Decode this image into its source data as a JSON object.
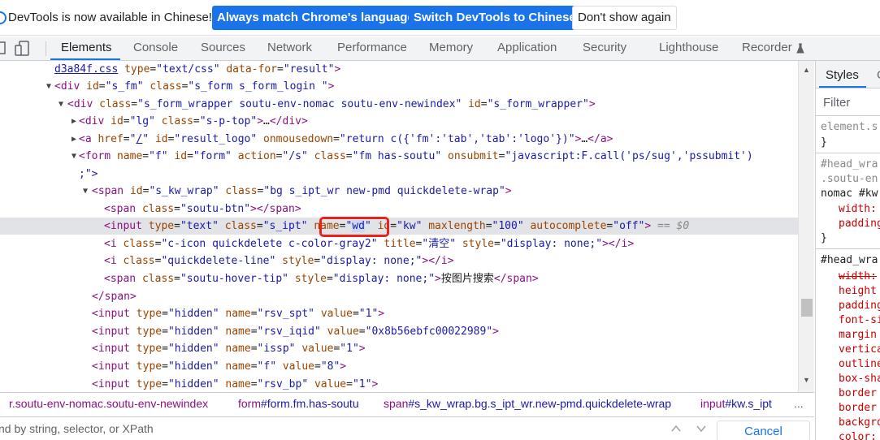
{
  "infobar": {
    "message": "DevTools is now available in Chinese!",
    "btn_match": "Always match Chrome's language",
    "btn_switch": "Switch DevTools to Chinese",
    "btn_dont": "Don't show again"
  },
  "tabs": {
    "elements": "Elements",
    "console": "Console",
    "sources": "Sources",
    "network": "Network",
    "performance": "Performance",
    "memory": "Memory",
    "application": "Application",
    "security": "Security",
    "lighthouse": "Lighthouse",
    "recorder": "Recorder"
  },
  "dom": {
    "l0": {
      "link": "d3a84f.css",
      "a1": "type",
      "v1": "text/css",
      "a2": "data-for",
      "v2": "result"
    },
    "l1": {
      "tag": "div",
      "a1": "id",
      "v1": "s_fm",
      "a2": "class",
      "v2": "s_form s_form_login "
    },
    "l2": {
      "tag": "div",
      "a1": "class",
      "v1": "s_form_wrapper soutu-env-nomac soutu-env-newindex",
      "a2": "id",
      "v2": "s_form_wrapper"
    },
    "l3": {
      "tag": "div",
      "a1": "id",
      "v1": "lg",
      "a2": "class",
      "v2": "s-p-top",
      "ell": "…"
    },
    "l4": {
      "tag": "a",
      "a1": "href",
      "v1": "/",
      "a2": "id",
      "v2": "result_logo",
      "a3": "onmousedown",
      "v3": "return c({'fm':'tab','tab':'logo'})",
      "ell": "…"
    },
    "l5": {
      "tag": "form",
      "a1": "name",
      "v1": "f",
      "a2": "id",
      "v2": "form",
      "a3": "action",
      "v3": "/s",
      "a4": "class",
      "v4": "fm  has-soutu",
      "a5": "onsubmit",
      "v5": "javascript:F.call('ps/sug','pssubmit')",
      "cont": ";\">"
    },
    "l6": {
      "tag": "span",
      "a1": "id",
      "v1": "s_kw_wrap",
      "a2": "class",
      "v2": "bg s_ipt_wr new-pmd quickdelete-wrap"
    },
    "l7": {
      "tag": "span",
      "a1": "class",
      "v1": "soutu-btn"
    },
    "l8": {
      "tag": "input",
      "a1": "type",
      "v1": "text",
      "a2": "class",
      "v2": "s_ipt",
      "a3": "name",
      "v3": "wd",
      "a4": "id",
      "v4": "kw",
      "a5": "maxlength",
      "v5": "100",
      "a6": "autocomplete",
      "v6": "off",
      "eq": "== $0"
    },
    "l9": {
      "tag": "i",
      "a1": "class",
      "v1": "c-icon quickdelete c-color-gray2",
      "a2": "title",
      "v2": "清空",
      "a3": "style",
      "v3": "display: none;",
      "text": ""
    },
    "l10": {
      "tag": "i",
      "a1": "class",
      "v1": "quickdelete-line",
      "a2": "style",
      "v2": "display: none;"
    },
    "l11": {
      "tag": "span",
      "a1": "class",
      "v1": "soutu-hover-tip",
      "a2": "style",
      "v2": "display: none;",
      "text": "按图片搜索"
    },
    "l12": {
      "tag": "span"
    },
    "hidden": [
      {
        "tag": "input",
        "a1": "type",
        "v1": "hidden",
        "a2": "name",
        "v2": "rsv_spt",
        "a3": "value",
        "v3": "1"
      },
      {
        "tag": "input",
        "a1": "type",
        "v1": "hidden",
        "a2": "name",
        "v2": "rsv_iqid",
        "a3": "value",
        "v3": "0x8b56ebfc00022989"
      },
      {
        "tag": "input",
        "a1": "type",
        "v1": "hidden",
        "a2": "name",
        "v2": "issp",
        "a3": "value",
        "v3": "1"
      },
      {
        "tag": "input",
        "a1": "type",
        "v1": "hidden",
        "a2": "name",
        "v2": "f",
        "a3": "value",
        "v3": "8"
      },
      {
        "tag": "input",
        "a1": "type",
        "v1": "hidden",
        "a2": "name",
        "v2": "rsv_bp",
        "a3": "value",
        "v3": "1"
      }
    ]
  },
  "breadcrumbs": {
    "c1": "r.soutu-env-nomac.soutu-env-newindex",
    "c2_tag": "form",
    "c2_rest": "#form.fm.has-soutu",
    "c3_tag": "span",
    "c3_rest": "#s_kw_wrap.bg.s_ipt_wr.new-pmd.quickdelete-wrap",
    "c4_tag": "input",
    "c4_rest": "#kw.s_ipt",
    "more": "..."
  },
  "search": {
    "placeholder": "nd by string, selector, or XPath",
    "cancel": "Cancel"
  },
  "styles": {
    "tab": "Styles",
    "tab2": "C",
    "filter": "Filter",
    "s1": "element.s",
    "s1_close": "}",
    "s2a": "#head_wra",
    "s2b": ".soutu-en",
    "s2c": "nomac #kw",
    "p_width": "width:",
    "p_padding": "padding",
    "s2_close": "}",
    "s3": "#head_wra",
    "props": [
      "width:",
      "height",
      "padding",
      "font-si",
      "margin",
      "vertica",
      "outline",
      "box-sha",
      "border",
      "border",
      "backgro",
      "color:"
    ]
  }
}
